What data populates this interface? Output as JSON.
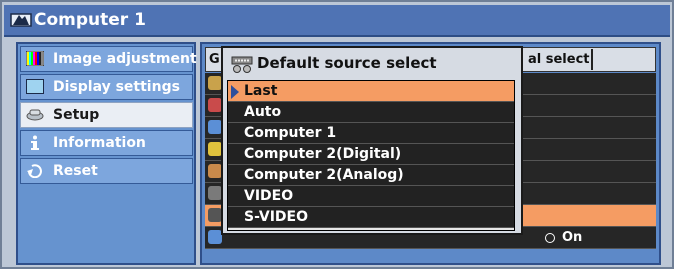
{
  "window": {
    "title": "Computer 1",
    "icon": "computer-source-icon"
  },
  "sidebar": {
    "items": [
      {
        "label": "Image adjustment",
        "icon": "image-adjustment-icon",
        "selected": false
      },
      {
        "label": "Display settings",
        "icon": "display-settings-icon",
        "selected": false
      },
      {
        "label": "Setup",
        "icon": "setup-icon",
        "selected": true
      },
      {
        "label": "Information",
        "icon": "information-icon",
        "selected": false
      },
      {
        "label": "Reset",
        "icon": "reset-icon",
        "selected": false
      }
    ]
  },
  "main": {
    "tabs": [
      {
        "label": "G"
      },
      {
        "label": "al select"
      }
    ],
    "row_value": {
      "label": "On",
      "control": "radio"
    }
  },
  "popup": {
    "title": "Default source select",
    "icon": "source-select-icon",
    "options": [
      {
        "label": "Last",
        "selected": true
      },
      {
        "label": "Auto",
        "selected": false
      },
      {
        "label": "Computer 1",
        "selected": false
      },
      {
        "label": "Computer 2(Digital)",
        "selected": false
      },
      {
        "label": "Computer 2(Analog)",
        "selected": false
      },
      {
        "label": "VIDEO",
        "selected": false
      },
      {
        "label": "S-VIDEO",
        "selected": false
      }
    ]
  },
  "colors": {
    "title_bar": "#4f73b4",
    "sidebar_bg": "#6693cf",
    "sidebar_item": "#7da6dd",
    "selected_sidebar": "#eaeef4",
    "highlight": "#f59c63",
    "list_bg": "#222222",
    "popup_bg": "#d6dbe3"
  }
}
